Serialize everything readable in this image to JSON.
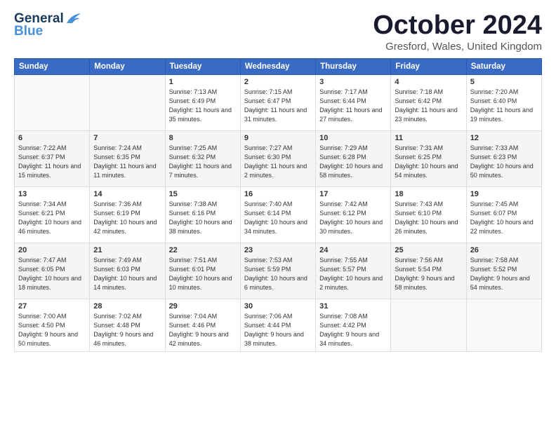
{
  "logo": {
    "line1": "General",
    "line2": "Blue"
  },
  "title": "October 2024",
  "subtitle": "Gresford, Wales, United Kingdom",
  "headers": [
    "Sunday",
    "Monday",
    "Tuesday",
    "Wednesday",
    "Thursday",
    "Friday",
    "Saturday"
  ],
  "weeks": [
    [
      {
        "day": "",
        "sunrise": "",
        "sunset": "",
        "daylight": ""
      },
      {
        "day": "",
        "sunrise": "",
        "sunset": "",
        "daylight": ""
      },
      {
        "day": "1",
        "sunrise": "Sunrise: 7:13 AM",
        "sunset": "Sunset: 6:49 PM",
        "daylight": "Daylight: 11 hours and 35 minutes."
      },
      {
        "day": "2",
        "sunrise": "Sunrise: 7:15 AM",
        "sunset": "Sunset: 6:47 PM",
        "daylight": "Daylight: 11 hours and 31 minutes."
      },
      {
        "day": "3",
        "sunrise": "Sunrise: 7:17 AM",
        "sunset": "Sunset: 6:44 PM",
        "daylight": "Daylight: 11 hours and 27 minutes."
      },
      {
        "day": "4",
        "sunrise": "Sunrise: 7:18 AM",
        "sunset": "Sunset: 6:42 PM",
        "daylight": "Daylight: 11 hours and 23 minutes."
      },
      {
        "day": "5",
        "sunrise": "Sunrise: 7:20 AM",
        "sunset": "Sunset: 6:40 PM",
        "daylight": "Daylight: 11 hours and 19 minutes."
      }
    ],
    [
      {
        "day": "6",
        "sunrise": "Sunrise: 7:22 AM",
        "sunset": "Sunset: 6:37 PM",
        "daylight": "Daylight: 11 hours and 15 minutes."
      },
      {
        "day": "7",
        "sunrise": "Sunrise: 7:24 AM",
        "sunset": "Sunset: 6:35 PM",
        "daylight": "Daylight: 11 hours and 11 minutes."
      },
      {
        "day": "8",
        "sunrise": "Sunrise: 7:25 AM",
        "sunset": "Sunset: 6:32 PM",
        "daylight": "Daylight: 11 hours and 7 minutes."
      },
      {
        "day": "9",
        "sunrise": "Sunrise: 7:27 AM",
        "sunset": "Sunset: 6:30 PM",
        "daylight": "Daylight: 11 hours and 2 minutes."
      },
      {
        "day": "10",
        "sunrise": "Sunrise: 7:29 AM",
        "sunset": "Sunset: 6:28 PM",
        "daylight": "Daylight: 10 hours and 58 minutes."
      },
      {
        "day": "11",
        "sunrise": "Sunrise: 7:31 AM",
        "sunset": "Sunset: 6:25 PM",
        "daylight": "Daylight: 10 hours and 54 minutes."
      },
      {
        "day": "12",
        "sunrise": "Sunrise: 7:33 AM",
        "sunset": "Sunset: 6:23 PM",
        "daylight": "Daylight: 10 hours and 50 minutes."
      }
    ],
    [
      {
        "day": "13",
        "sunrise": "Sunrise: 7:34 AM",
        "sunset": "Sunset: 6:21 PM",
        "daylight": "Daylight: 10 hours and 46 minutes."
      },
      {
        "day": "14",
        "sunrise": "Sunrise: 7:36 AM",
        "sunset": "Sunset: 6:19 PM",
        "daylight": "Daylight: 10 hours and 42 minutes."
      },
      {
        "day": "15",
        "sunrise": "Sunrise: 7:38 AM",
        "sunset": "Sunset: 6:16 PM",
        "daylight": "Daylight: 10 hours and 38 minutes."
      },
      {
        "day": "16",
        "sunrise": "Sunrise: 7:40 AM",
        "sunset": "Sunset: 6:14 PM",
        "daylight": "Daylight: 10 hours and 34 minutes."
      },
      {
        "day": "17",
        "sunrise": "Sunrise: 7:42 AM",
        "sunset": "Sunset: 6:12 PM",
        "daylight": "Daylight: 10 hours and 30 minutes."
      },
      {
        "day": "18",
        "sunrise": "Sunrise: 7:43 AM",
        "sunset": "Sunset: 6:10 PM",
        "daylight": "Daylight: 10 hours and 26 minutes."
      },
      {
        "day": "19",
        "sunrise": "Sunrise: 7:45 AM",
        "sunset": "Sunset: 6:07 PM",
        "daylight": "Daylight: 10 hours and 22 minutes."
      }
    ],
    [
      {
        "day": "20",
        "sunrise": "Sunrise: 7:47 AM",
        "sunset": "Sunset: 6:05 PM",
        "daylight": "Daylight: 10 hours and 18 minutes."
      },
      {
        "day": "21",
        "sunrise": "Sunrise: 7:49 AM",
        "sunset": "Sunset: 6:03 PM",
        "daylight": "Daylight: 10 hours and 14 minutes."
      },
      {
        "day": "22",
        "sunrise": "Sunrise: 7:51 AM",
        "sunset": "Sunset: 6:01 PM",
        "daylight": "Daylight: 10 hours and 10 minutes."
      },
      {
        "day": "23",
        "sunrise": "Sunrise: 7:53 AM",
        "sunset": "Sunset: 5:59 PM",
        "daylight": "Daylight: 10 hours and 6 minutes."
      },
      {
        "day": "24",
        "sunrise": "Sunrise: 7:55 AM",
        "sunset": "Sunset: 5:57 PM",
        "daylight": "Daylight: 10 hours and 2 minutes."
      },
      {
        "day": "25",
        "sunrise": "Sunrise: 7:56 AM",
        "sunset": "Sunset: 5:54 PM",
        "daylight": "Daylight: 9 hours and 58 minutes."
      },
      {
        "day": "26",
        "sunrise": "Sunrise: 7:58 AM",
        "sunset": "Sunset: 5:52 PM",
        "daylight": "Daylight: 9 hours and 54 minutes."
      }
    ],
    [
      {
        "day": "27",
        "sunrise": "Sunrise: 7:00 AM",
        "sunset": "Sunset: 4:50 PM",
        "daylight": "Daylight: 9 hours and 50 minutes."
      },
      {
        "day": "28",
        "sunrise": "Sunrise: 7:02 AM",
        "sunset": "Sunset: 4:48 PM",
        "daylight": "Daylight: 9 hours and 46 minutes."
      },
      {
        "day": "29",
        "sunrise": "Sunrise: 7:04 AM",
        "sunset": "Sunset: 4:46 PM",
        "daylight": "Daylight: 9 hours and 42 minutes."
      },
      {
        "day": "30",
        "sunrise": "Sunrise: 7:06 AM",
        "sunset": "Sunset: 4:44 PM",
        "daylight": "Daylight: 9 hours and 38 minutes."
      },
      {
        "day": "31",
        "sunrise": "Sunrise: 7:08 AM",
        "sunset": "Sunset: 4:42 PM",
        "daylight": "Daylight: 9 hours and 34 minutes."
      },
      {
        "day": "",
        "sunrise": "",
        "sunset": "",
        "daylight": ""
      },
      {
        "day": "",
        "sunrise": "",
        "sunset": "",
        "daylight": ""
      }
    ]
  ]
}
